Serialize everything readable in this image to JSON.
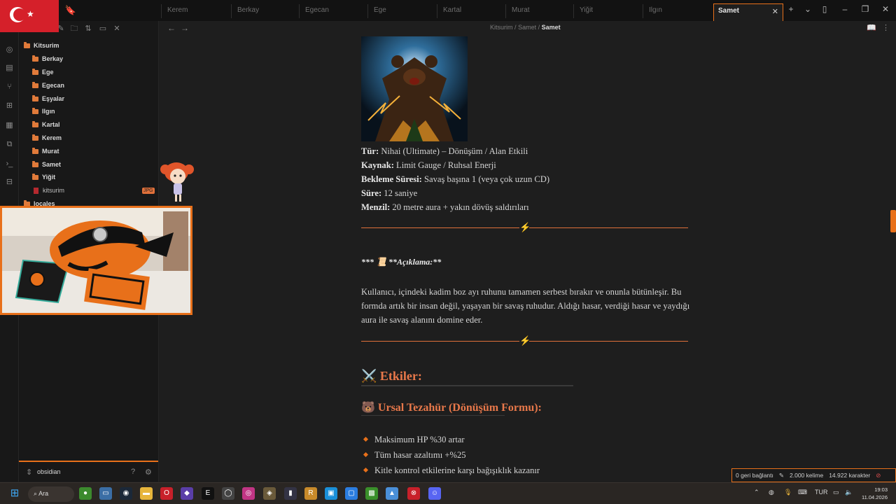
{
  "tabs": [
    "Kerem",
    "Berkay",
    "Egecan",
    "Ege",
    "Kartal",
    "Murat",
    "Yiğit",
    "Ilgın",
    "Samet"
  ],
  "active_tab": "Samet",
  "breadcrumb": {
    "root": "Kitsurim",
    "sep1": "/",
    "parent": "Samet",
    "sep2": "/",
    "current": "Samet"
  },
  "sidebar": {
    "root": "Kitsurim",
    "folders": [
      "Berkay",
      "Ege",
      "Egecan",
      "Eşyalar",
      "Ilgın",
      "Kartal",
      "Kerem",
      "Murat",
      "Samet",
      "Yiğit"
    ],
    "file": "kitsurim",
    "file_badge": "JPG",
    "partial_folder": "locales",
    "vault_name": "obsidian"
  },
  "note": {
    "properties": [
      {
        "key": "Tür:",
        "value": " Nihai (Ultimate) – Dönüşüm / Alan Etkili"
      },
      {
        "key": "Kaynak:",
        "value": " Limit Gauge / Ruhsal Enerji"
      },
      {
        "key": "Bekleme Süresi:",
        "value": " Savaş başına 1 (veya çok uzun CD)"
      },
      {
        "key": "Süre:",
        "value": " 12 saniye"
      },
      {
        "key": "Menzil:",
        "value": " 20 metre aura + yakın dövüş saldırıları"
      }
    ],
    "aciklama_label": "*** 📜 **Açıklama:**",
    "paragraph": "Kullanıcı, içindeki kadim boz ayı ruhunu tamamen serbest bırakır ve onunla bütünleşir. Bu formda artık bir insan değil, yaşayan bir savaş ruhudur. Aldığı hasar, verdiği hasar ve yaydığı aura ile savaş alanını domine eder.",
    "heading2": "⚔️ Etkiler:",
    "heading3": "🐻 Ursal Tezahür (Dönüşüm Formu):",
    "bullets": [
      "Maksimum HP %30 artar",
      "Tüm hasar azaltımı +%25",
      "Kitle kontrol etkilerine karşı bağışıklık kazanır"
    ],
    "divider_icon": "lightning-bolt-icon"
  },
  "status": {
    "backlinks": "0 geri bağlantı",
    "words": "2.000 kelime",
    "chars": "14.922 karakter"
  },
  "taskbar": {
    "search_label": "Ara",
    "lang": "TUR",
    "time": "19:03",
    "date": "11.04.2026"
  },
  "colors": {
    "accent": "#e8701a",
    "heading": "#e8784a",
    "background": "#1e1e1e",
    "sidebar": "#181818"
  }
}
